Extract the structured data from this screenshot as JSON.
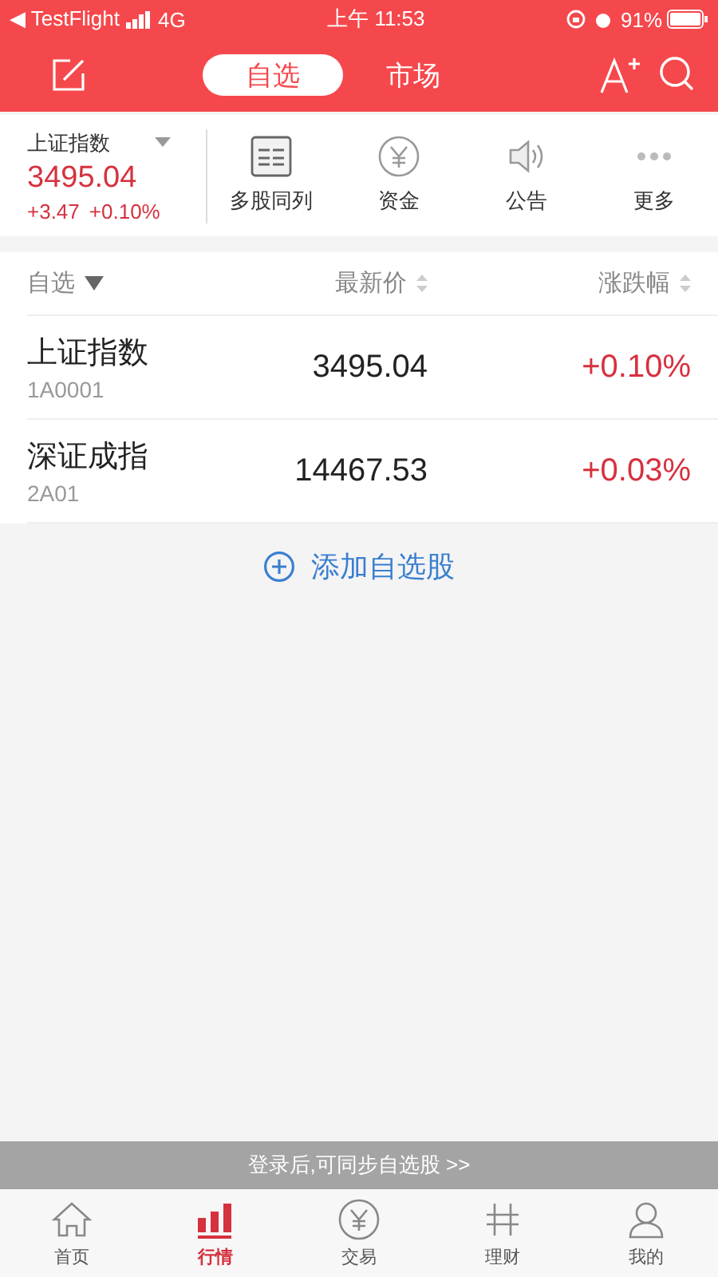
{
  "status_bar": {
    "back_label": "◀ TestFlight",
    "network": "4G",
    "time": "上午 11:53",
    "battery": "91%"
  },
  "header": {
    "tabs": [
      {
        "label": "自选",
        "selected": true
      },
      {
        "label": "市场",
        "selected": false
      }
    ]
  },
  "index_panel": {
    "name": "上证指数",
    "value": "3495.04",
    "change": "+3.47",
    "percent": "+0.10%"
  },
  "shortcuts": [
    {
      "kind": "list",
      "label": "多股同列"
    },
    {
      "kind": "coin",
      "label": "资金"
    },
    {
      "kind": "speaker",
      "label": "公告"
    },
    {
      "kind": "more",
      "label": "更多"
    }
  ],
  "table": {
    "columns": [
      "自选",
      "最新价",
      "涨跌幅"
    ],
    "rows": [
      {
        "name": "上证指数",
        "code": "1A0001",
        "price": "3495.04",
        "change": "+0.10%"
      },
      {
        "name": "深证成指",
        "code": "2A01",
        "price": "14467.53",
        "change": "+0.03%"
      }
    ]
  },
  "add_button": "添加自选股",
  "login_banner": "登录后,可同步自选股 >>",
  "bottom_tabs": [
    {
      "kind": "home",
      "label": "首页",
      "selected": false
    },
    {
      "kind": "chart",
      "label": "行情",
      "selected": true
    },
    {
      "kind": "coin",
      "label": "交易",
      "selected": false
    },
    {
      "kind": "finance",
      "label": "理财",
      "selected": false
    },
    {
      "kind": "person",
      "label": "我的",
      "selected": false
    }
  ]
}
